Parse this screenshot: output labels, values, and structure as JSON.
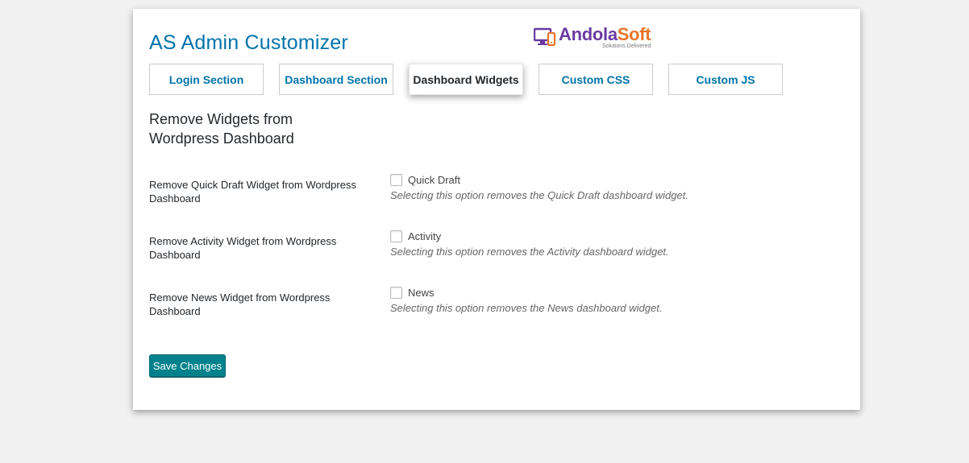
{
  "app": {
    "title": "AS Admin Customizer"
  },
  "logo": {
    "brand_part1": "Andola",
    "brand_part2": "Soft",
    "tagline": "Solutions Delivered",
    "colors": {
      "primary": "#6a3ba0",
      "secondary": "#e8742a"
    }
  },
  "tabs": [
    {
      "label": "Login Section",
      "active": false
    },
    {
      "label": "Dashboard Section",
      "active": false
    },
    {
      "label": "Dashboard Widgets",
      "active": true
    },
    {
      "label": "Custom CSS",
      "active": false
    },
    {
      "label": "Custom JS",
      "active": false
    }
  ],
  "section": {
    "heading": "Remove Widgets from Wordpress Dashboard"
  },
  "options": [
    {
      "label": "Remove Quick Draft Widget from Wordpress Dashboard",
      "checkbox_label": "Quick Draft",
      "checked": false,
      "description": "Selecting this option removes the Quick Draft dashboard widget."
    },
    {
      "label": "Remove Activity Widget from Wordpress Dashboard",
      "checkbox_label": "Activity",
      "checked": false,
      "description": "Selecting this option removes the Activity dashboard widget."
    },
    {
      "label": "Remove News Widget from Wordpress Dashboard",
      "checkbox_label": "News",
      "checked": false,
      "description": "Selecting this option removes the News dashboard widget."
    }
  ],
  "actions": {
    "save_label": "Save Changes"
  },
  "colors": {
    "accent": "#0073aa",
    "button": "#00828c",
    "background": "#f1f1f1"
  }
}
